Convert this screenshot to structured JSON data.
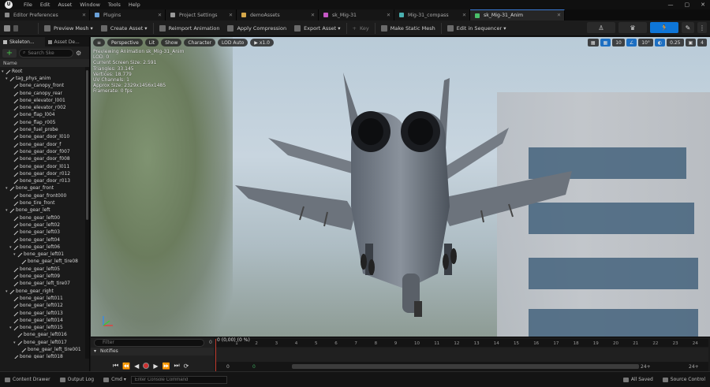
{
  "app": {
    "logo": "U",
    "menu": [
      "File",
      "Edit",
      "Asset",
      "Window",
      "Tools",
      "Help"
    ],
    "window_buttons": [
      "—",
      "▢",
      "✕"
    ]
  },
  "tabs": [
    {
      "label": "Editor Preferences",
      "icon_color": "#8a8a8a",
      "active": false
    },
    {
      "label": "Plugins",
      "icon_color": "#6aa0d8",
      "active": false
    },
    {
      "label": "Project Settings",
      "icon_color": "#9a9a9a",
      "active": false
    },
    {
      "label": "demoAssets",
      "icon_color": "#d6a84a",
      "active": false
    },
    {
      "label": "sk_Mig-31",
      "icon_color": "#c558c5",
      "active": false
    },
    {
      "label": "Mig-31_compass",
      "icon_color": "#4ab0b0",
      "active": false
    },
    {
      "label": "sk_Mig-31_Anim",
      "icon_color": "#4ac06a",
      "active": true
    }
  ],
  "toolbar": {
    "items": [
      "Preview Mesh ▾",
      "Create Asset ▾",
      "Reimport Animation",
      "Apply Compression",
      "Export Asset ▾",
      "Key",
      "Make Static Mesh",
      "Edit in Sequencer ▾"
    ],
    "modes": [
      "♙",
      "♛",
      "🏃",
      "✎",
      "⋮"
    ]
  },
  "left_panel": {
    "tabs": [
      "Skeleton...",
      "Asset De..."
    ],
    "search_placeholder": "Search Ske",
    "column_header": "Name",
    "bones": [
      {
        "label": "Root",
        "depth": 0,
        "exp": true
      },
      {
        "label": "tag_phys_anim",
        "depth": 1,
        "exp": true
      },
      {
        "label": "bone_canopy_front",
        "depth": 2,
        "exp": false
      },
      {
        "label": "bone_canopy_rear",
        "depth": 2,
        "exp": false
      },
      {
        "label": "bone_elevator_l001",
        "depth": 2,
        "exp": false
      },
      {
        "label": "bone_elevator_r002",
        "depth": 2,
        "exp": false
      },
      {
        "label": "bone_flap_l004",
        "depth": 2,
        "exp": false
      },
      {
        "label": "bone_flap_r005",
        "depth": 2,
        "exp": false
      },
      {
        "label": "bone_fuel_probe",
        "depth": 2,
        "exp": false
      },
      {
        "label": "bone_gear_door_l010",
        "depth": 2,
        "exp": false
      },
      {
        "label": "bone_gear_door_f",
        "depth": 2,
        "exp": false
      },
      {
        "label": "bone_gear_door_f007",
        "depth": 2,
        "exp": false
      },
      {
        "label": "bone_gear_door_f008",
        "depth": 2,
        "exp": false
      },
      {
        "label": "bone_gear_door_l011",
        "depth": 2,
        "exp": false
      },
      {
        "label": "bone_gear_door_r012",
        "depth": 2,
        "exp": false
      },
      {
        "label": "bone_gear_door_r013",
        "depth": 2,
        "exp": false
      },
      {
        "label": "bone_gear_front",
        "depth": 1,
        "exp": true
      },
      {
        "label": "bone_gear_front000",
        "depth": 2,
        "exp": false
      },
      {
        "label": "bone_tire_front",
        "depth": 2,
        "exp": false
      },
      {
        "label": "bone_gear_left",
        "depth": 1,
        "exp": true
      },
      {
        "label": "bone_gear_left00",
        "depth": 2,
        "exp": false
      },
      {
        "label": "bone_gear_left02",
        "depth": 2,
        "exp": false
      },
      {
        "label": "bone_gear_left03",
        "depth": 2,
        "exp": false
      },
      {
        "label": "bone_gear_left04",
        "depth": 2,
        "exp": false
      },
      {
        "label": "bone_gear_left06",
        "depth": 2,
        "exp": true
      },
      {
        "label": "bone_gear_left01",
        "depth": 3,
        "exp": true
      },
      {
        "label": "bone_gear_left_tire08",
        "depth": 4,
        "exp": false
      },
      {
        "label": "bone_gear_left05",
        "depth": 2,
        "exp": false
      },
      {
        "label": "bone_gear_left09",
        "depth": 2,
        "exp": false
      },
      {
        "label": "bone_gear_left_tire07",
        "depth": 2,
        "exp": false
      },
      {
        "label": "bone_gear_right",
        "depth": 1,
        "exp": true
      },
      {
        "label": "bone_gear_left011",
        "depth": 2,
        "exp": false
      },
      {
        "label": "bone_gear_left012",
        "depth": 2,
        "exp": false
      },
      {
        "label": "bone_gear_left013",
        "depth": 2,
        "exp": false
      },
      {
        "label": "bone_gear_left014",
        "depth": 2,
        "exp": false
      },
      {
        "label": "bone_gear_left015",
        "depth": 2,
        "exp": true
      },
      {
        "label": "bone_gear_left016",
        "depth": 3,
        "exp": false
      },
      {
        "label": "bone_gear_left017",
        "depth": 3,
        "exp": true
      },
      {
        "label": "bone_gear_left_tire001",
        "depth": 4,
        "exp": false
      },
      {
        "label": "bone_gear_left018",
        "depth": 2,
        "exp": false
      }
    ]
  },
  "viewport": {
    "tools": [
      "≡",
      "Perspective",
      "Lit",
      "Show",
      "Character",
      "LOD Auto",
      "▶ x1.0"
    ],
    "right_tools": [
      "▦",
      "10",
      "∠",
      "10°",
      "◐",
      "0.25",
      "▣",
      "4"
    ],
    "info_lines": [
      "Previewing Animation sk_Mig-31_Anim",
      "LOD: 0",
      "Current Screen Size: 2.591",
      "Triangles: 33.145",
      "Vertices: 18.779",
      "UV Channels: 1",
      "Approx Size: 2329x1456x1485",
      "Framerate: 0 fps"
    ]
  },
  "timeline": {
    "filter_placeholder": "Filter",
    "notifies_label": "Notifies",
    "frame_readout": "0 (0,00) (0 %)",
    "start_left": "0",
    "ticks": [
      "0",
      "1",
      "2",
      "3",
      "4",
      "5",
      "6",
      "7",
      "8",
      "9",
      "10",
      "11",
      "12",
      "13",
      "14",
      "15",
      "16",
      "17",
      "18",
      "19",
      "20",
      "21",
      "22",
      "23",
      "24"
    ],
    "range_start": "0",
    "range_start2": "0",
    "range_end": "24+",
    "range_end2": "24+",
    "transport": [
      "⏮",
      "⏪",
      "◀",
      "●",
      "▶",
      "⏩",
      "⏭",
      "⟳"
    ]
  },
  "statusbar": {
    "content_drawer": "Content Drawer",
    "output_log": "Output Log",
    "cmd": "Cmd ▾",
    "cmd_placeholder": "Enter Console Command",
    "all_saved": "All Saved",
    "source_control": "Source Control"
  }
}
